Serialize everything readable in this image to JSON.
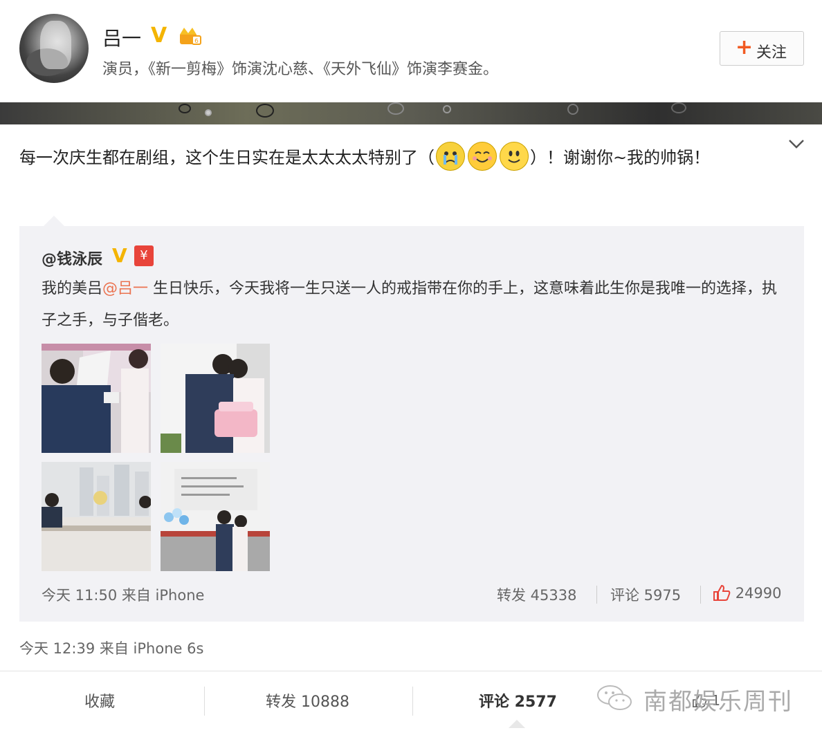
{
  "profile": {
    "name": "吕一",
    "verified_badge": "V",
    "bio": "演员，《新一剪梅》饰演沈心慈、《天外飞仙》饰演李赛金。",
    "follow_plus": "+",
    "follow_label": "关注",
    "accent_color": "#f15a22",
    "verified_color": "#f4b400"
  },
  "post": {
    "text_before_emoji": "每一次庆生都在剧组，这个生日实在是太太太太特别了（",
    "emojis": [
      "crying-face-icon",
      "smiling-face-icon",
      "smiley-face-icon"
    ],
    "text_after_emoji": "）！谢谢你~我的帅锅！",
    "timestamp": "今天 12:39 来自 iPhone 6s"
  },
  "repost": {
    "user": "@钱泳辰",
    "verified_badge": "V",
    "red_badge": "¥",
    "text_part1": "我的美吕",
    "mention": "@吕一",
    "text_part2": " 生日快乐，今天我将一生只送一人的戒指带在你的手上，这意味着此生你是我唯一的选择，执子之手，与子偕老。",
    "meta": "今天 11:50 来自 iPhone",
    "reposts": "转发 45338",
    "comments": "评论 5975",
    "likes": "24990"
  },
  "action_bar": {
    "favorite": "收藏",
    "repost": "转发 10888",
    "comment": "评论 2577",
    "like_count": "1",
    "watermark": "南都娱乐周刊"
  }
}
